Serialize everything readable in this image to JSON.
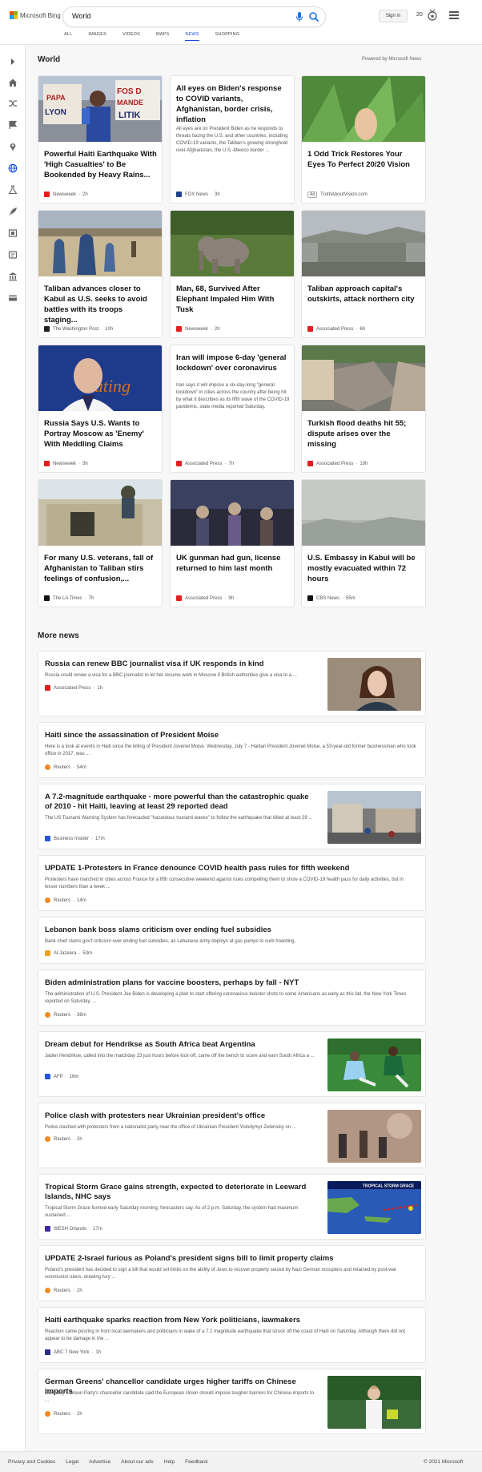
{
  "header": {
    "logo_text": "Microsoft Bing",
    "query": "World",
    "signin": "Sign in",
    "points": "20",
    "scopes": [
      "ALL",
      "IMAGES",
      "VIDEOS",
      "MAPS",
      "NEWS",
      "SHOPPING"
    ],
    "active_scope": "NEWS"
  },
  "rail": {
    "icons": [
      "chevron-right-icon",
      "home-icon",
      "shuffle-icon",
      "flag-icon",
      "location-icon",
      "globe-icon",
      "science-icon",
      "rocket-icon",
      "film-icon",
      "sports-icon",
      "landmark-icon",
      "card-icon"
    ],
    "active": "globe-icon"
  },
  "world": {
    "title": "World",
    "powered": "Powered by Microsoft News",
    "cards": [
      {
        "title": "Powerful Haiti Earthquake With 'High Casualties' to Be Bookended by Heavy Rains...",
        "source": "Newsweek",
        "time": "2h",
        "src_color": "#e0201f"
      },
      {
        "title": "All eyes on Biden's response to COVID variants, Afghanistan, border crisis, inflation",
        "snippet": "All eyes are on President Biden as he responds to threats facing the U.S. and other countries, including COVID-19 variants, the Taliban's growing stronghold over Afghanistan, the U.S.-Mexico border ...",
        "source": "FOX News",
        "time": "3h",
        "src_color": "#1d3f8f"
      },
      {
        "title": "1 Odd Trick Restores Your Eyes To Perfect 20/20 Vision",
        "source": "TruthAboutVision.com",
        "ad": "Ad",
        "src_color": "#ffffff"
      },
      {
        "title": "Taliban advances closer to Kabul as U.S. seeks to avoid battles with its troops staging...",
        "source": "The Washington Post",
        "time": "10h",
        "src_color": "#222222"
      },
      {
        "title": "Man, 68, Survived After Elephant Impaled Him With Tusk",
        "source": "Newsweek",
        "time": "2h",
        "src_color": "#e0201f"
      },
      {
        "title": "Taliban approach capital's outskirts, attack northern city",
        "source": "Associated Press",
        "time": "6h",
        "src_color": "#e0201f"
      },
      {
        "title": "Russia Says U.S. Wants to Portray Moscow as 'Enemy' With Meddling Claims",
        "source": "Newsweek",
        "time": "3h",
        "src_color": "#e0201f"
      },
      {
        "title": "Iran will impose 6-day 'general lockdown' over coronavirus",
        "snippet": "Iran says it will impose a six-day-long \"general lockdown\" in cities across the country after being hit by what it describes as its fifth wave of the COVID-19 pandemic, state media reported Saturday.",
        "source": "Associated Press",
        "time": "7h",
        "src_color": "#e0201f"
      },
      {
        "title": "Turkish flood deaths hit 55; dispute arises over the missing",
        "source": "Associated Press",
        "time": "10h",
        "src_color": "#e0201f"
      },
      {
        "title": "For many U.S. veterans, fall of Afghanistan to Taliban stirs feelings of confusion,...",
        "source": "The LA Times",
        "time": "7h",
        "src_color": "#111111"
      },
      {
        "title": "UK gunman had gun, license returned to him last month",
        "source": "Associated Press",
        "time": "9h",
        "src_color": "#e0201f"
      },
      {
        "title": "U.S. Embassy in Kabul will be mostly evacuated within 72 hours",
        "source": "CBS News",
        "time": "55m",
        "src_color": "#111111"
      }
    ]
  },
  "more": {
    "title": "More news",
    "items": [
      {
        "title": "Russia can renew BBC journalist visa if UK responds in kind",
        "snippet": "Russia could renew a visa for a BBC journalist to let her resume work in Moscow if British authorities give a visa to a ...",
        "source": "Associated Press",
        "time": "1h",
        "src_color": "#e0201f"
      },
      {
        "title": "Haiti since the assassination of President Moise",
        "snippet": "Here is a look at events in Haiti since the killing of President Jovenel Moise. Wednesday, July 7 - Haitian President Jovenel Moise, a 53-year-old former businessman who took office in 2017, was ...",
        "source": "Reuters",
        "time": "54m",
        "src_color": "#f08a24"
      },
      {
        "title": "A 7.2-magnitude earthquake - more powerful than the catastrophic quake of 2010 - hit Haiti, leaving at least 29 reported dead",
        "snippet": "The US Tsunami Warning System has forecasted \"hazardous tsunami waves\" to follow the earthquake that killed at least 29 ...",
        "source": "Business Insider",
        "time": "17m",
        "src_color": "#2456d8"
      },
      {
        "title": "UPDATE 1-Protesters in France denounce COVID health pass rules for fifth weekend",
        "snippet": "Protesters have marched in cities across France for a fifth consecutive weekend against rules compelling them to show a COVID-19 health pass for daily activities, but in lesser numbers than a week ...",
        "source": "Reuters",
        "time": "14m",
        "src_color": "#f08a24"
      },
      {
        "title": "Lebanon bank boss slams criticism over ending fuel subsidies",
        "snippet": "Bank chief slams gov't criticism over ending fuel subsidies, as Lebanese army deploys at gas pumps to curb hoarding.",
        "source": "Al Jazeera",
        "time": "53m",
        "src_color": "#f0a020"
      },
      {
        "title": "Biden administration plans for vaccine boosters, perhaps by fall - NYT",
        "snippet": "The administration of U.S. President Joe Biden is developing a plan to start offering coronavirus booster shots to some Americans as early as this fall, the New York Times reported on Saturday, ...",
        "source": "Reuters",
        "time": "36m",
        "src_color": "#f08a24"
      },
      {
        "title": "Dream debut for Hendrikse as South Africa beat Argentina",
        "snippet": "Jaden Hendrikse, called into the matchday 23 just hours before kick-off, came off the bench to score and earn South Africa a ...",
        "source": "AFP",
        "time": "16m",
        "src_color": "#2456d8"
      },
      {
        "title": "Police clash with protesters near Ukrainian president's office",
        "snippet": "Police clashed with protesters from a nationalist party near the office of Ukrainian President Volodymyr Zelenskiy on ...",
        "source": "Reuters",
        "time": "2h",
        "src_color": "#f08a24"
      },
      {
        "title": "Tropical Storm Grace gains strength, expected to deteriorate in Leeward Islands, NHC says",
        "snippet": "Tropical Storm Grace formed early Saturday morning, forecasters say. As of 2 p.m. Saturday, the system had maximum sustained ...",
        "source": "WESH Orlando",
        "time": "17m",
        "src_color": "#3a2ca0",
        "thumb_caption": "TROPICAL STORM GRACE"
      },
      {
        "title": "UPDATE 2-Israel furious as Poland's president signs bill to limit property claims",
        "snippet": "Poland's president has decided to sign a bill that would set limits on the ability of Jews to recover property seized by Nazi German occupiers and retained by post-war communist rulers, drawing fury ...",
        "source": "Reuters",
        "time": "2h",
        "src_color": "#f08a24"
      },
      {
        "title": "Haiti earthquake sparks reaction from New York politicians, lawmakers",
        "snippet": "Reaction came pouring in from local lawmakers and politicians in wake of a 7.2 magnitude earthquake that struck off the coast of Haiti on Saturday. Although there did not appear to be damage in the ...",
        "source": "ABC 7 New York",
        "time": "1h",
        "src_color": "#2a2a8a"
      },
      {
        "title": "German Greens' chancellor candidate urges higher tariffs on Chinese imports",
        "snippet": "Germany's Green Party's chancellor candidate said the European Union should impose tougher barriers for Chinese imports to ...",
        "source": "Reuters",
        "time": "2h",
        "src_color": "#f08a24"
      }
    ]
  },
  "footer": {
    "links": [
      "Privacy and Cookies",
      "Legal",
      "Advertise",
      "About our ads",
      "Help",
      "Feedback"
    ],
    "copyright": "© 2021 Microsoft"
  }
}
